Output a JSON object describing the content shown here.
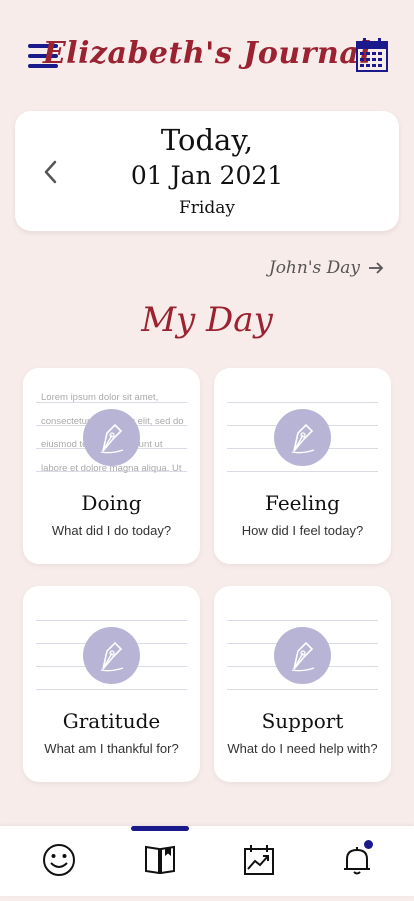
{
  "header": {
    "title": "Elizabeth's Journal",
    "menu_icon": "hamburger-menu-icon",
    "calendar_icon": "calendar-icon"
  },
  "date_card": {
    "today_label": "Today,",
    "date": "01 Jan 2021",
    "weekday": "Friday"
  },
  "other_day_link": "John's Day",
  "section_title": "My Day",
  "cards": [
    {
      "title": "Doing",
      "subtitle": "What did I do today?",
      "preview": "Lorem ipsum dolor sit amet, consectetur adipiscing elit, sed do eiusmod tempor incididunt ut labore et dolore magna aliqua. Ut"
    },
    {
      "title": "Feeling",
      "subtitle": "How did I feel today?"
    },
    {
      "title": "Gratitude",
      "subtitle": "What am I thankful for?"
    },
    {
      "title": "Support",
      "subtitle": "What do I need help with?"
    }
  ],
  "bottom_nav": {
    "items": [
      "mood-face-icon",
      "journal-book-icon",
      "trend-chart-icon",
      "bell-icon"
    ],
    "active_index": 1,
    "has_notification": true
  },
  "colors": {
    "accent": "#1a1a8c",
    "title": "#9b2230",
    "background": "#f8eceb",
    "pen_circle": "#b7b4d6"
  }
}
